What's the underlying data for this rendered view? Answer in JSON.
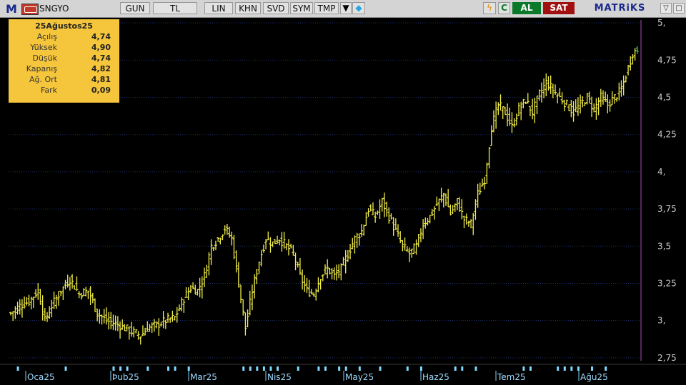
{
  "toolbar": {
    "logo": "M",
    "symbol": "SNGYO",
    "period": "GUN",
    "currency": "TL",
    "buttons": [
      "LIN",
      "KHN",
      "SVD",
      "SYM",
      "TMP"
    ],
    "dropdown_icon": "triangle-down-icon",
    "share_icon": "twitter-bird-icon",
    "lightning_icon": "lightning-icon",
    "refresh_label": "C",
    "buy_label": "AL",
    "sell_label": "SAT",
    "brand": "MATRiKS",
    "window_controls": [
      "▽",
      "□"
    ]
  },
  "info_box": {
    "date": "25Ağustos25",
    "rows": [
      {
        "label": "Açılış",
        "value": "4,74"
      },
      {
        "label": "Yüksek",
        "value": "4,90"
      },
      {
        "label": "Düşük",
        "value": "4,74"
      },
      {
        "label": "Kapanış",
        "value": "4,82"
      },
      {
        "label": "Ağ. Ort",
        "value": "4,81"
      },
      {
        "label": "Fark",
        "value": "0,09"
      }
    ]
  },
  "colors": {
    "background": "#000000",
    "bars": "#f2ee4a",
    "grid": "#1f2f6a",
    "axis_text": "#c8c8c8",
    "month_text": "#9fdcff",
    "tick_marks": "#7fd8ff",
    "last_bar": "#3bd16a",
    "cursor_line": "#b04cc0"
  },
  "chart_data": {
    "type": "ohlc",
    "y_ticks": [
      "2,75",
      "3,",
      "3,25",
      "3,5",
      "3,75",
      "4,",
      "4,25",
      "4,5",
      "4,75",
      "5,"
    ],
    "y_values": [
      2.75,
      3.0,
      3.25,
      3.5,
      3.75,
      4.0,
      4.25,
      4.5,
      4.75,
      5.0
    ],
    "ylim": [
      2.73,
      5.02
    ],
    "months": [
      "Oca25",
      "Þub25",
      "Mar25",
      "Nis25",
      "May25",
      "Haz25",
      "Tem25",
      "Ağu25"
    ],
    "close_anchors": [
      [
        0,
        3.05
      ],
      [
        4,
        3.1
      ],
      [
        8,
        3.13
      ],
      [
        12,
        3.2
      ],
      [
        15,
        3.0
      ],
      [
        18,
        3.1
      ],
      [
        22,
        3.2
      ],
      [
        26,
        3.28
      ],
      [
        30,
        3.18
      ],
      [
        34,
        3.2
      ],
      [
        38,
        3.05
      ],
      [
        42,
        3.0
      ],
      [
        46,
        2.98
      ],
      [
        50,
        2.95
      ],
      [
        54,
        2.92
      ],
      [
        57,
        2.9
      ],
      [
        60,
        2.95
      ],
      [
        64,
        2.97
      ],
      [
        68,
        3.0
      ],
      [
        72,
        3.02
      ],
      [
        76,
        3.15
      ],
      [
        79,
        3.22
      ],
      [
        82,
        3.2
      ],
      [
        85,
        3.3
      ],
      [
        88,
        3.5
      ],
      [
        91,
        3.55
      ],
      [
        94,
        3.62
      ],
      [
        97,
        3.55
      ],
      [
        100,
        3.25
      ],
      [
        103,
        2.95
      ],
      [
        106,
        3.2
      ],
      [
        109,
        3.4
      ],
      [
        112,
        3.55
      ],
      [
        115,
        3.52
      ],
      [
        118,
        3.55
      ],
      [
        121,
        3.5
      ],
      [
        124,
        3.45
      ],
      [
        127,
        3.3
      ],
      [
        130,
        3.2
      ],
      [
        133,
        3.18
      ],
      [
        136,
        3.3
      ],
      [
        139,
        3.35
      ],
      [
        142,
        3.3
      ],
      [
        145,
        3.35
      ],
      [
        148,
        3.45
      ],
      [
        151,
        3.55
      ],
      [
        154,
        3.6
      ],
      [
        157,
        3.75
      ],
      [
        160,
        3.7
      ],
      [
        163,
        3.8
      ],
      [
        166,
        3.7
      ],
      [
        169,
        3.6
      ],
      [
        172,
        3.5
      ],
      [
        175,
        3.45
      ],
      [
        178,
        3.5
      ],
      [
        181,
        3.65
      ],
      [
        184,
        3.7
      ],
      [
        187,
        3.78
      ],
      [
        190,
        3.85
      ],
      [
        193,
        3.72
      ],
      [
        196,
        3.8
      ],
      [
        199,
        3.68
      ],
      [
        202,
        3.65
      ],
      [
        205,
        3.85
      ],
      [
        208,
        3.95
      ],
      [
        211,
        4.3
      ],
      [
        214,
        4.45
      ],
      [
        217,
        4.4
      ],
      [
        220,
        4.3
      ],
      [
        223,
        4.42
      ],
      [
        226,
        4.48
      ],
      [
        229,
        4.4
      ],
      [
        232,
        4.52
      ],
      [
        235,
        4.6
      ],
      [
        238,
        4.55
      ],
      [
        241,
        4.5
      ],
      [
        244,
        4.45
      ],
      [
        247,
        4.4
      ],
      [
        250,
        4.45
      ],
      [
        253,
        4.5
      ],
      [
        256,
        4.42
      ],
      [
        259,
        4.5
      ],
      [
        262,
        4.45
      ],
      [
        265,
        4.5
      ],
      [
        268,
        4.55
      ],
      [
        270,
        4.65
      ],
      [
        273,
        4.8
      ],
      [
        275,
        4.82
      ]
    ]
  }
}
